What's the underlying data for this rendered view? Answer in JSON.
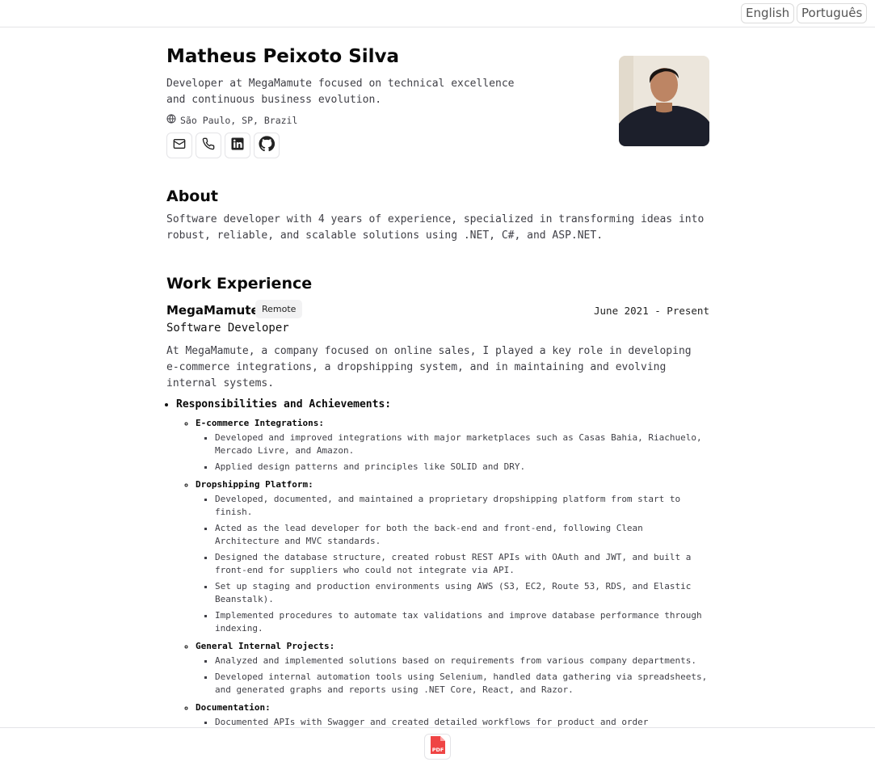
{
  "languages": [
    "English",
    "Português"
  ],
  "profile": {
    "name": "Matheus Peixoto Silva",
    "tagline": "Developer at MegaMamute focused on technical excellence and continuous business evolution.",
    "location": "São Paulo, SP, Brazil",
    "contact_icons": [
      "mail-icon",
      "phone-icon",
      "linkedin-icon",
      "github-icon"
    ]
  },
  "about": {
    "heading": "About",
    "text": "Software developer with 4 years of experience, specialized in transforming ideas into robust, reliable, and scalable solutions using .NET, C#, and ASP.NET."
  },
  "work": {
    "heading": "Work Experience",
    "company": "MegaMamute",
    "badge": "Remote",
    "period": "June 2021 - Present",
    "role": "Software Developer",
    "description": "At MegaMamute, a company focused on online sales, I played a key role in developing e-commerce integrations, a dropshipping system, and in maintaining and evolving internal systems.",
    "responsibilities_heading": "Responsibilities and Achievements:",
    "groups": [
      {
        "title": "E-commerce Integrations:",
        "items": [
          "Developed and improved integrations with major marketplaces such as Casas Bahia, Riachuelo, Mercado Livre, and Amazon.",
          "Applied design patterns and principles like SOLID and DRY."
        ]
      },
      {
        "title": "Dropshipping Platform:",
        "items": [
          "Developed, documented, and maintained a proprietary dropshipping platform from start to finish.",
          "Acted as the lead developer for both the back-end and front-end, following Clean Architecture and MVC standards.",
          "Designed the database structure, created robust REST APIs with OAuth and JWT, and built a front-end for suppliers who could not integrate via API.",
          "Set up staging and production environments using AWS (S3, EC2, Route 53, RDS, and Elastic Beanstalk).",
          "Implemented procedures to automate tax validations and improve database performance through indexing."
        ]
      },
      {
        "title": "General Internal Projects:",
        "items": [
          "Analyzed and implemented solutions based on requirements from various company departments.",
          "Developed internal automation tools using Selenium, handled data gathering via spreadsheets, and generated graphs and reports using .NET Core, React, and Razor."
        ]
      },
      {
        "title": "Documentation:",
        "items": [
          "Documented APIs with Swagger and created detailed workflows for product and order"
        ]
      }
    ]
  },
  "pdf_label": "PDF",
  "colors": {
    "pdf_accent": "#ef4444",
    "text_muted": "#3f3f46",
    "border": "#e4e4e7"
  }
}
